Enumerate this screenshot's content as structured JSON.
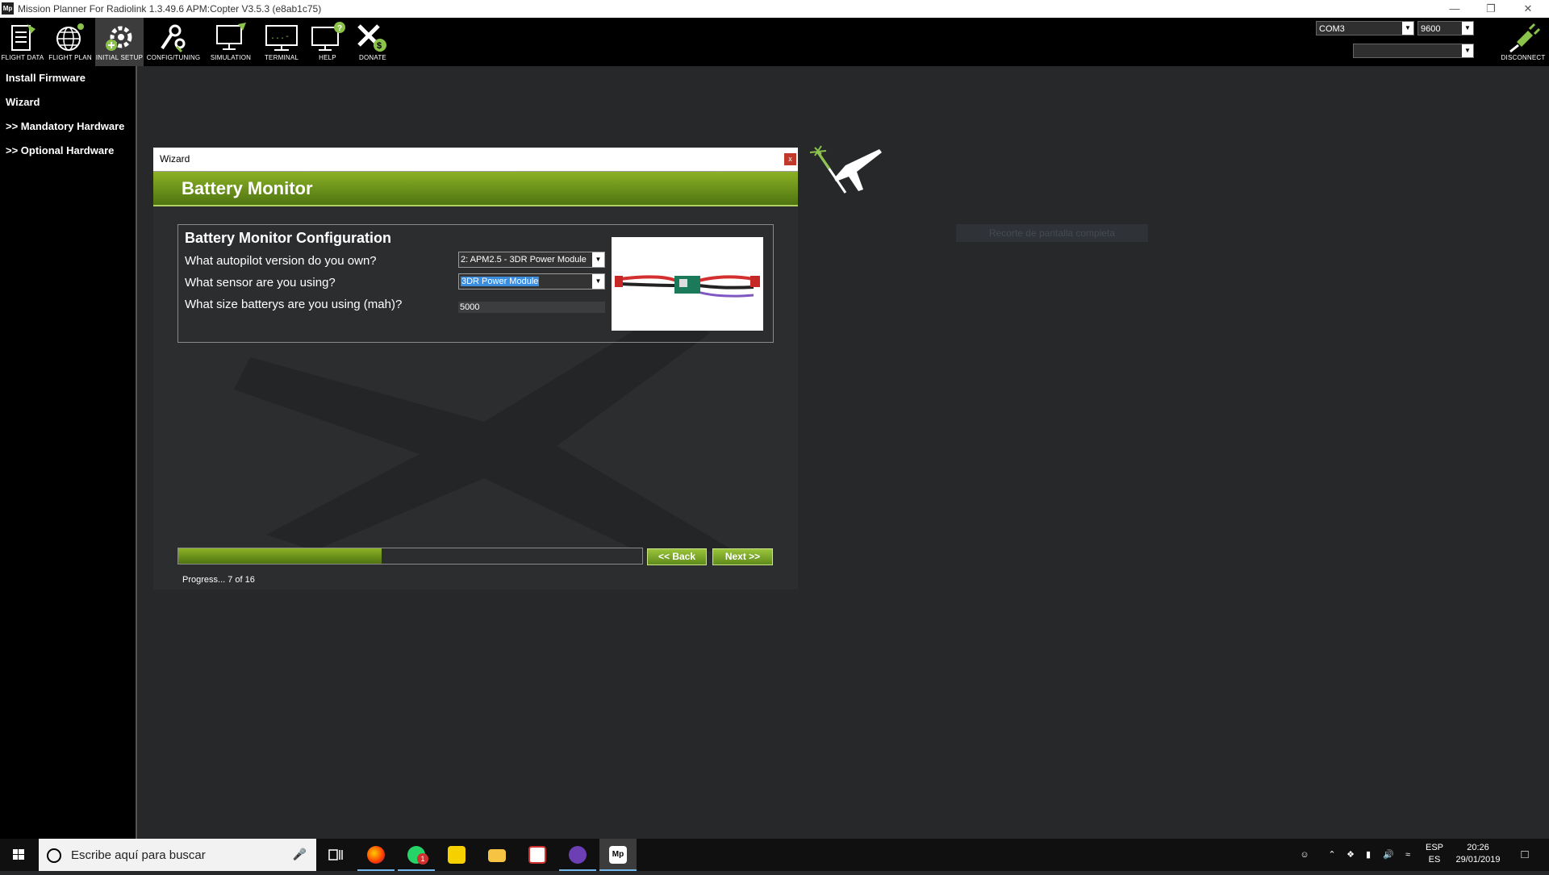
{
  "window": {
    "icon_text": "Mp",
    "title": "Mission Planner For Radiolink 1.3.49.6 APM:Copter V3.5.3 (e8ab1c75)",
    "minimize_icon": "minimize-icon",
    "restore_icon": "restore-icon",
    "close_icon": "close-icon"
  },
  "toolbar": {
    "buttons": [
      {
        "label": "FLIGHT DATA",
        "icon": "flight-data-icon"
      },
      {
        "label": "FLIGHT PLAN",
        "icon": "flight-plan-icon"
      },
      {
        "label": "INITIAL SETUP",
        "icon": "initial-setup-icon",
        "active": true
      },
      {
        "label": "CONFIG/TUNING",
        "icon": "config-tuning-icon"
      },
      {
        "label": "SIMULATION",
        "icon": "simulation-icon"
      },
      {
        "label": "TERMINAL",
        "icon": "terminal-icon"
      },
      {
        "label": "HELP",
        "icon": "help-icon"
      },
      {
        "label": "DONATE",
        "icon": "donate-icon"
      }
    ],
    "port": "COM3",
    "baud": "9600",
    "link_select": "",
    "connect_label": "DISCONNECT"
  },
  "sidebar": {
    "items": [
      {
        "label": "Install Firmware"
      },
      {
        "label": "Wizard"
      },
      {
        "label": ">> Mandatory Hardware"
      },
      {
        "label": ">> Optional Hardware"
      }
    ]
  },
  "wizard": {
    "window_title": "Wizard",
    "close_label": "x",
    "header": "Battery Monitor",
    "section_title": "Battery Monitor Configuration",
    "questions": {
      "autopilot": "What autopilot version do you own?",
      "sensor": "What sensor are you using?",
      "capacity": "What size batterys are you using (mah)?"
    },
    "autopilot_value": "2: APM2.5 - 3DR Power Module",
    "sensor_value": "3DR Power Module",
    "capacity_value": "5000",
    "back_label": "<< Back",
    "next_label": "Next >>",
    "progress_text": "Progress... 7 of 16",
    "progress_current": 7,
    "progress_total": 16
  },
  "overlay": {
    "ghost_text": "Recorte de pantalla completa"
  },
  "taskbar": {
    "search_placeholder": "Escribe aquí para buscar",
    "apps": [
      "task-view-icon",
      "firefox-icon",
      "whatsapp-icon",
      "sticky-notes-icon",
      "file-explorer-icon",
      "pdf-icon",
      "purple-app-icon",
      "mission-planner-icon"
    ],
    "whatsapp_badge": "1",
    "mp_icon_text": "Mp",
    "lang_top": "ESP",
    "lang_bottom": "ES",
    "time": "20:26",
    "date": "29/01/2019"
  },
  "colors": {
    "accent_green": "#6e9a1c",
    "background": "#26282a",
    "selection_blue": "#3b8de0"
  }
}
